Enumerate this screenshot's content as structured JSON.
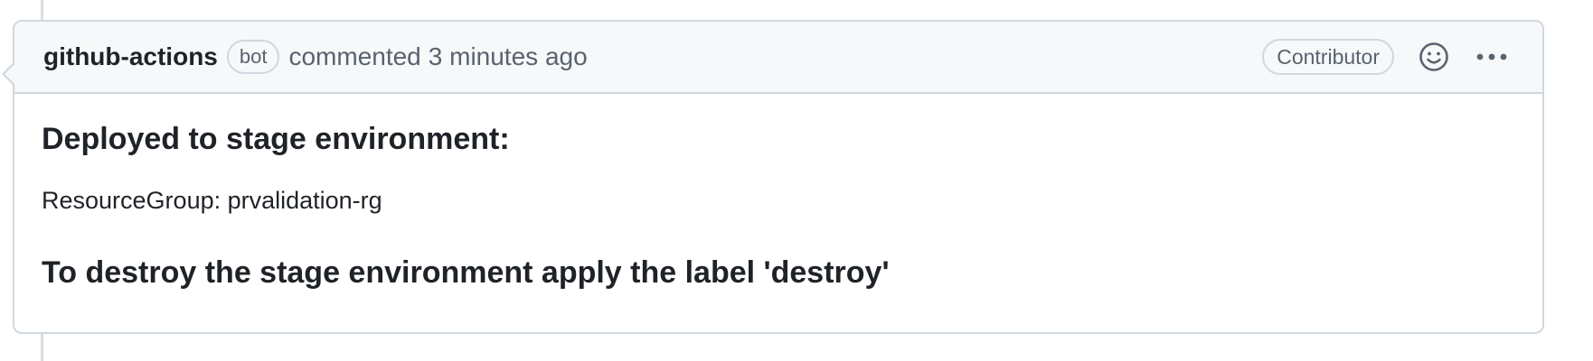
{
  "comment": {
    "author": "github-actions",
    "author_badge": "bot",
    "action_text": "commented",
    "timestamp": "3 minutes ago",
    "role_badge": "Contributor",
    "icons": {
      "reaction": "smiley-icon",
      "menu": "kebab-horizontal-icon"
    },
    "body": {
      "heading": "Deployed to stage environment:",
      "resource_line": "ResourceGroup: prvalidation-rg",
      "instruction": "To destroy the stage environment apply the label 'destroy'"
    }
  }
}
